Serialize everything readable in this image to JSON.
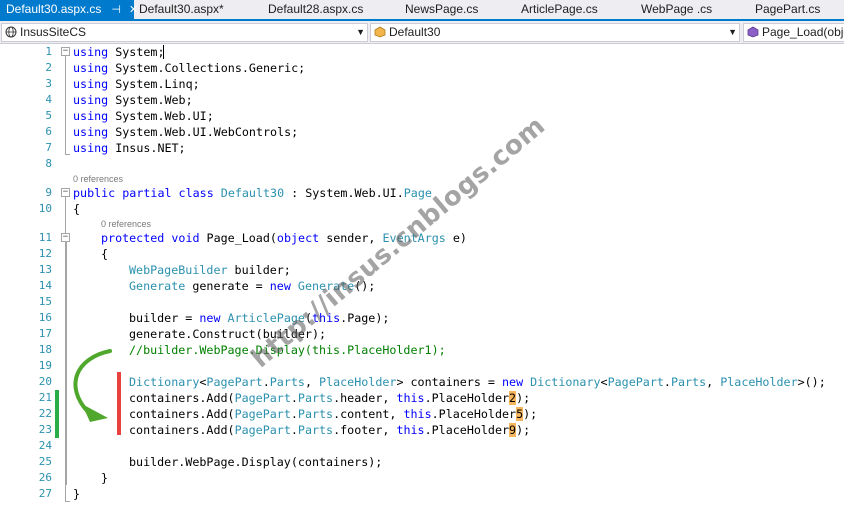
{
  "tabs": [
    {
      "label": "Default30.aspx.cs",
      "active": true
    },
    {
      "label": "Default30.aspx*",
      "active": false
    },
    {
      "label": "Default28.aspx.cs",
      "active": false
    },
    {
      "label": "NewsPage.cs",
      "active": false
    },
    {
      "label": "ArticlePage.cs",
      "active": false
    },
    {
      "label": "WebPage .cs",
      "active": false
    },
    {
      "label": "PagePart.cs",
      "active": false
    }
  ],
  "tab_pin_glyph": "⊣",
  "tab_close_glyph": "✕",
  "navbar": {
    "project": "InsusSiteCS",
    "class": "Default30",
    "member": "Page_Load(obje"
  },
  "codelens": {
    "class_refs": "0 references",
    "method_refs": "0 references"
  },
  "line_numbers": [
    "1",
    "2",
    "3",
    "4",
    "5",
    "6",
    "7",
    "8",
    "9",
    "10",
    "11",
    "12",
    "13",
    "14",
    "15",
    "16",
    "17",
    "18",
    "19",
    "20",
    "21",
    "22",
    "23",
    "24",
    "25",
    "26",
    "27"
  ],
  "code": {
    "l1": [
      "using",
      " System;"
    ],
    "l2": [
      "using",
      " System.Collections.Generic;"
    ],
    "l3": [
      "using",
      " System.Linq;"
    ],
    "l4": [
      "using",
      " System.Web;"
    ],
    "l5": [
      "using",
      " System.Web.UI;"
    ],
    "l6": [
      "using",
      " System.Web.UI.WebControls;"
    ],
    "l7": [
      "using",
      " Insus.NET;"
    ],
    "l9": [
      "public partial class",
      " ",
      "Default30",
      " : System.Web.UI.",
      "Page"
    ],
    "l10": "{",
    "l11": [
      "protected void",
      " Page_Load(",
      "object",
      " sender, ",
      "EventArgs",
      " e)"
    ],
    "l12": "{",
    "l13": [
      "WebPageBuilder",
      " builder;"
    ],
    "l14": [
      "Generate",
      " generate = ",
      "new",
      " ",
      "Generate",
      "();"
    ],
    "l16": [
      "builder = ",
      "new",
      " ",
      "ArticlePage",
      "(",
      "this",
      ".Page);"
    ],
    "l17": "generate.Construct(builder);",
    "l18": "//builder.WebPage.Display(this.PlaceHolder1);",
    "l20": [
      "Dictionary",
      "<",
      "PagePart",
      ".",
      "Parts",
      ", ",
      "PlaceHolder",
      "> containers = ",
      "new",
      " ",
      "Dictionary",
      "<",
      "PagePart",
      ".",
      "Parts",
      ", ",
      "PlaceHolder",
      ">();"
    ],
    "l21": [
      "containers.Add(",
      "PagePart",
      ".",
      "Parts",
      ".header, ",
      "this",
      ".PlaceHolder",
      "2",
      ");"
    ],
    "l22": [
      "containers.Add(",
      "PagePart",
      ".",
      "Parts",
      ".content, ",
      "this",
      ".PlaceHolder",
      "5",
      ");"
    ],
    "l23": [
      "containers.Add(",
      "PagePart",
      ".",
      "Parts",
      ".footer, ",
      "this",
      ".PlaceHolder",
      "9",
      ");"
    ],
    "l25": "builder.WebPage.Display(containers);",
    "l26": "}",
    "l27": "}"
  },
  "watermark": "http://insus.cnblogs.com",
  "colors": {
    "keyword": "#0000ff",
    "type": "#2b91af",
    "comment": "#008000",
    "highlight": "#f5b65e",
    "tab_active": "#007acc",
    "annotation_red": "#e8423f",
    "annotation_green": "#27ae47"
  }
}
